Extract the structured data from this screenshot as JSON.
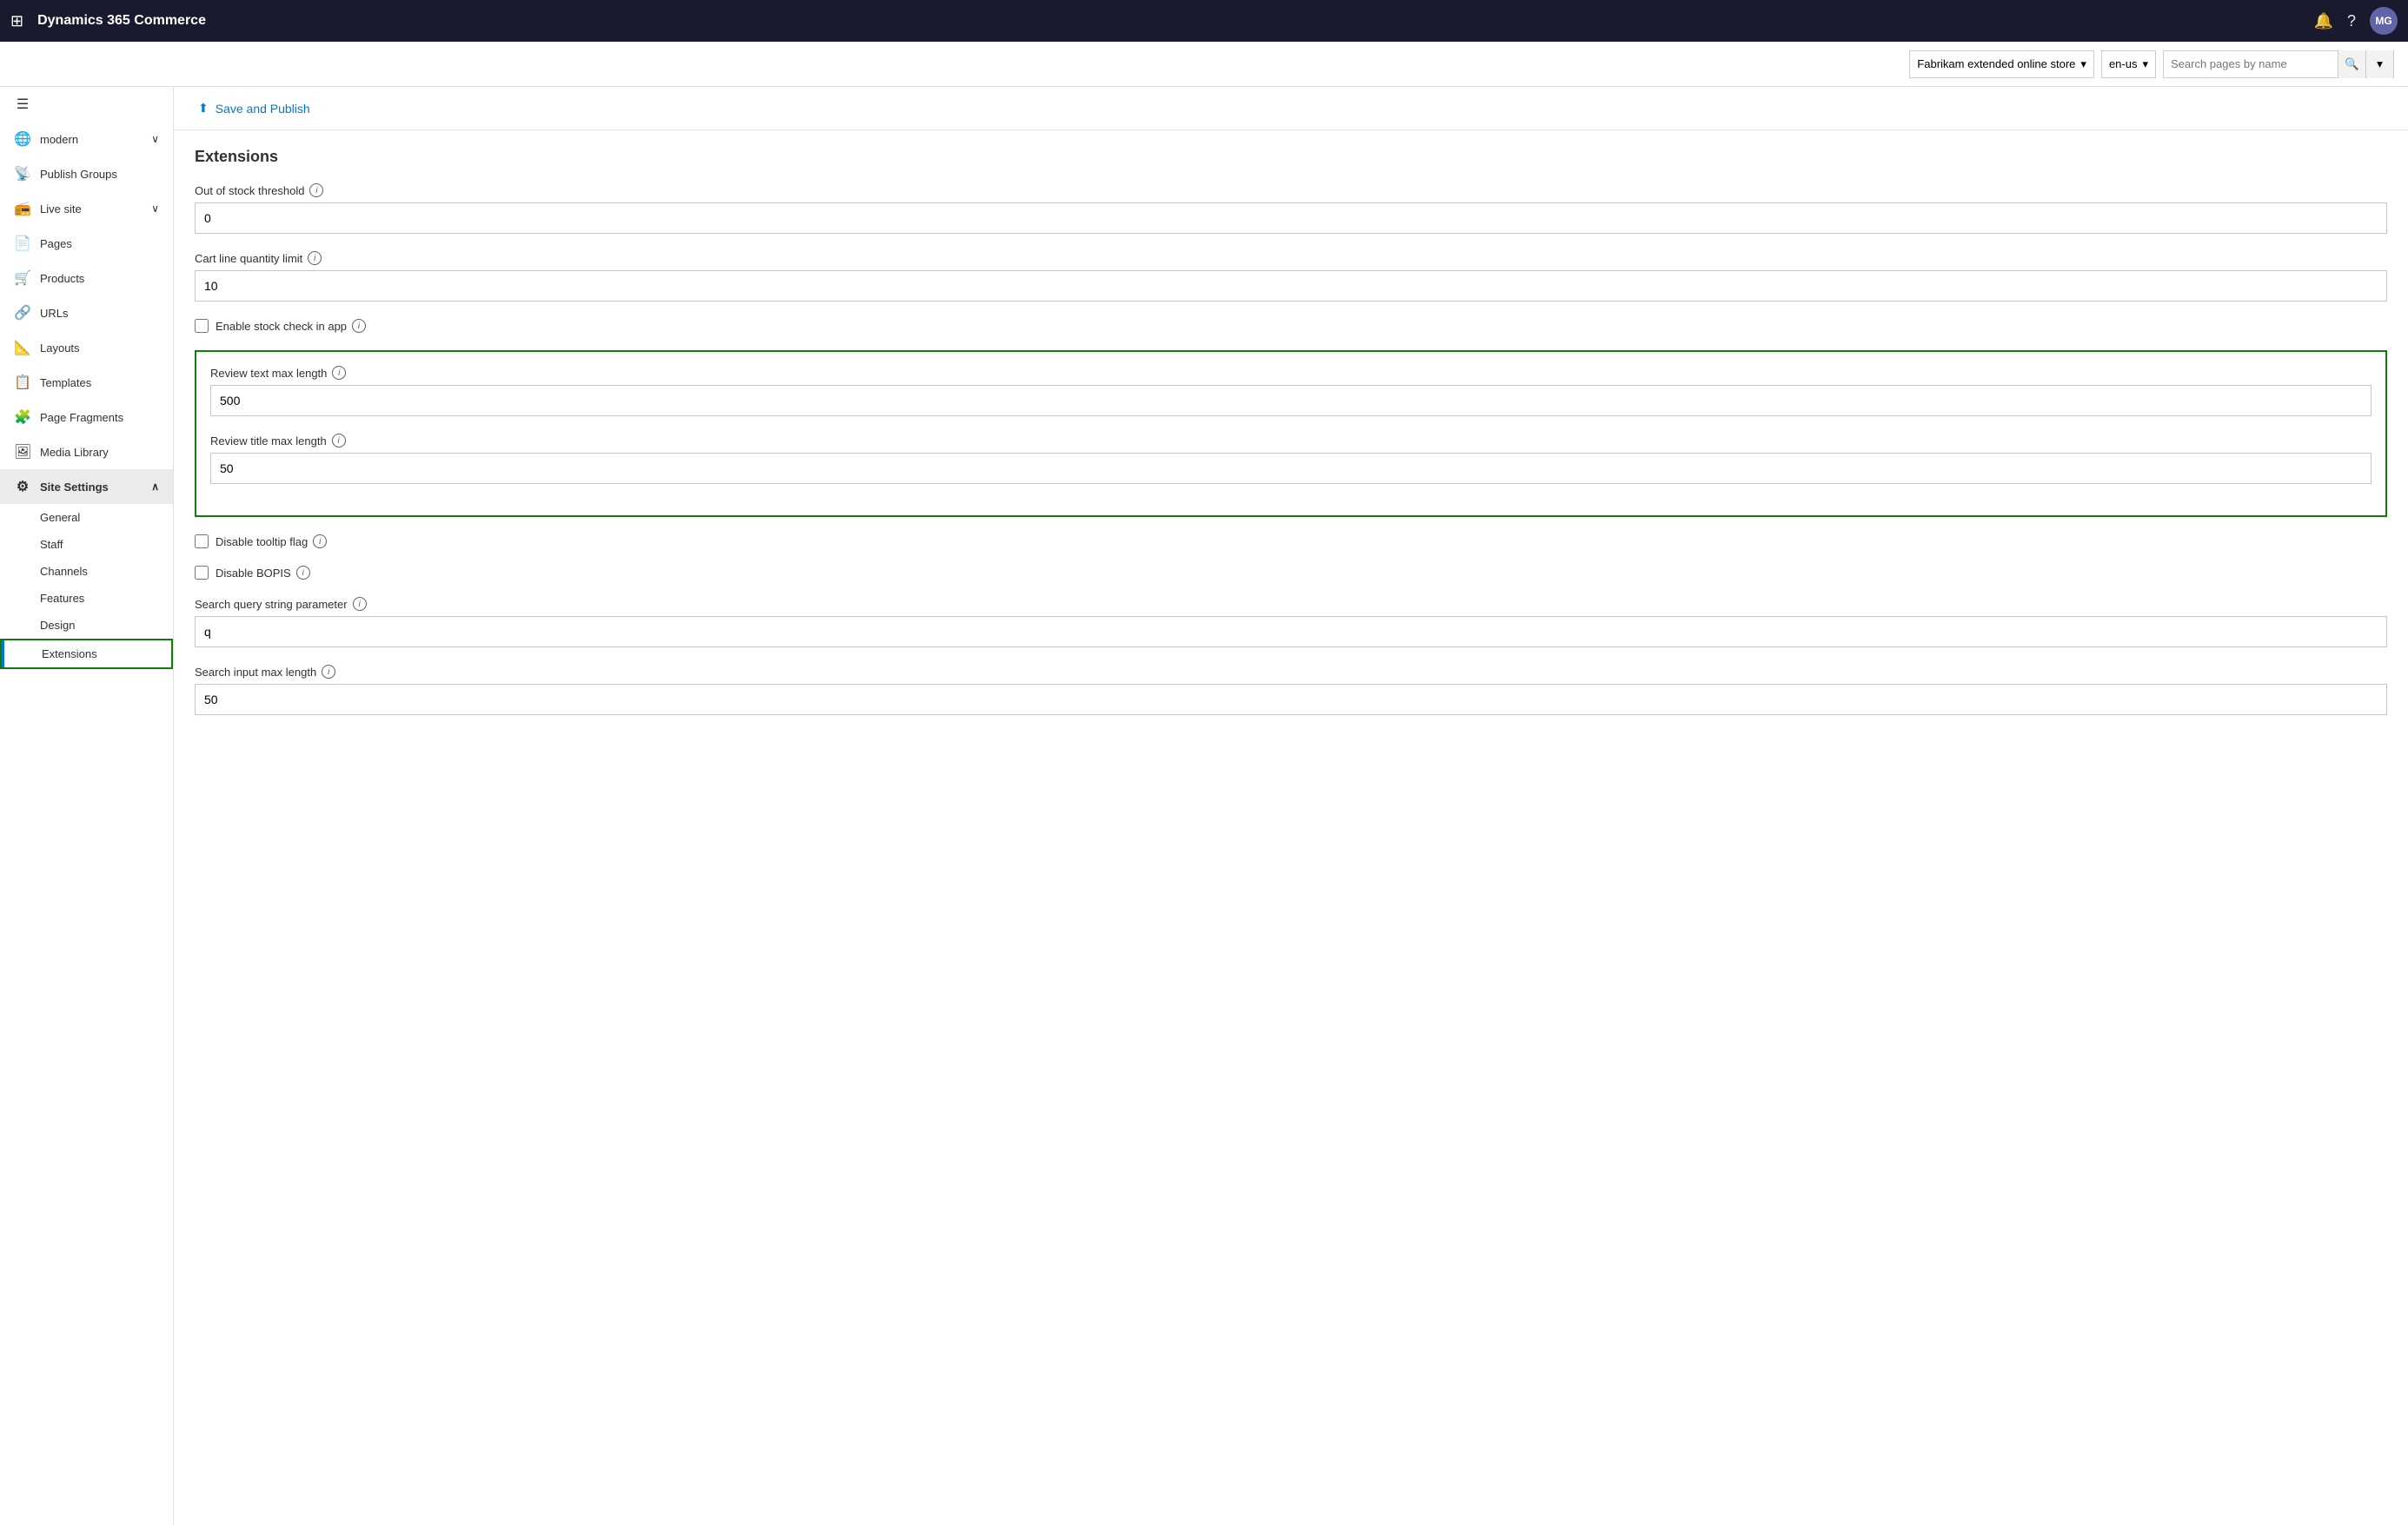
{
  "app": {
    "title": "Dynamics 365 Commerce"
  },
  "topbar": {
    "title": "Dynamics 365 Commerce",
    "avatar_initials": "MG"
  },
  "toolbar": {
    "store_label": "Fabrikam extended online store",
    "locale_label": "en-us",
    "search_placeholder": "Search pages by name"
  },
  "sidebar": {
    "collapse_icon": "☰",
    "items": [
      {
        "id": "modern",
        "label": "modern",
        "icon": "🌐",
        "has_chevron": true,
        "expanded": false
      },
      {
        "id": "publish-groups",
        "label": "Publish Groups",
        "icon": "📡",
        "has_chevron": false
      },
      {
        "id": "live-site",
        "label": "Live site",
        "icon": "📻",
        "has_chevron": true,
        "expanded": false
      },
      {
        "id": "pages",
        "label": "Pages",
        "icon": "📄",
        "has_chevron": false
      },
      {
        "id": "products",
        "label": "Products",
        "icon": "🛒",
        "has_chevron": false
      },
      {
        "id": "urls",
        "label": "URLs",
        "icon": "🔗",
        "has_chevron": false
      },
      {
        "id": "layouts",
        "label": "Layouts",
        "icon": "📐",
        "has_chevron": false
      },
      {
        "id": "templates",
        "label": "Templates",
        "icon": "📋",
        "has_chevron": false
      },
      {
        "id": "page-fragments",
        "label": "Page Fragments",
        "icon": "🧩",
        "has_chevron": false
      },
      {
        "id": "media-library",
        "label": "Media Library",
        "icon": "🖼",
        "has_chevron": false
      },
      {
        "id": "site-settings",
        "label": "Site Settings",
        "icon": "⚙",
        "has_chevron": true,
        "expanded": true
      }
    ],
    "sub_items": [
      {
        "id": "general",
        "label": "General"
      },
      {
        "id": "staff",
        "label": "Staff"
      },
      {
        "id": "channels",
        "label": "Channels"
      },
      {
        "id": "features",
        "label": "Features"
      },
      {
        "id": "design",
        "label": "Design"
      },
      {
        "id": "extensions",
        "label": "Extensions",
        "active": true
      }
    ]
  },
  "action_bar": {
    "save_publish_label": "Save and Publish"
  },
  "content": {
    "section_title": "Extensions",
    "fields": [
      {
        "id": "out-of-stock-threshold",
        "label": "Out of stock threshold",
        "has_info": true,
        "type": "text",
        "value": "0"
      },
      {
        "id": "cart-line-quantity-limit",
        "label": "Cart line quantity limit",
        "has_info": true,
        "type": "text",
        "value": "10"
      },
      {
        "id": "enable-stock-check",
        "label": "Enable stock check in app",
        "has_info": true,
        "type": "checkbox",
        "checked": false
      }
    ],
    "highlighted_fields": [
      {
        "id": "review-text-max-length",
        "label": "Review text max length",
        "has_info": true,
        "type": "text",
        "value": "500"
      },
      {
        "id": "review-title-max-length",
        "label": "Review title max length",
        "has_info": true,
        "type": "text",
        "value": "50"
      }
    ],
    "fields_after": [
      {
        "id": "disable-tooltip-flag",
        "label": "Disable tooltip flag",
        "has_info": true,
        "type": "checkbox",
        "checked": false
      },
      {
        "id": "disable-bopis",
        "label": "Disable BOPIS",
        "has_info": true,
        "type": "checkbox",
        "checked": false
      },
      {
        "id": "search-query-string-parameter",
        "label": "Search query string parameter",
        "has_info": true,
        "type": "text",
        "value": "q"
      },
      {
        "id": "search-input-max-length",
        "label": "Search input max length",
        "has_info": true,
        "type": "text",
        "value": "50"
      }
    ]
  }
}
